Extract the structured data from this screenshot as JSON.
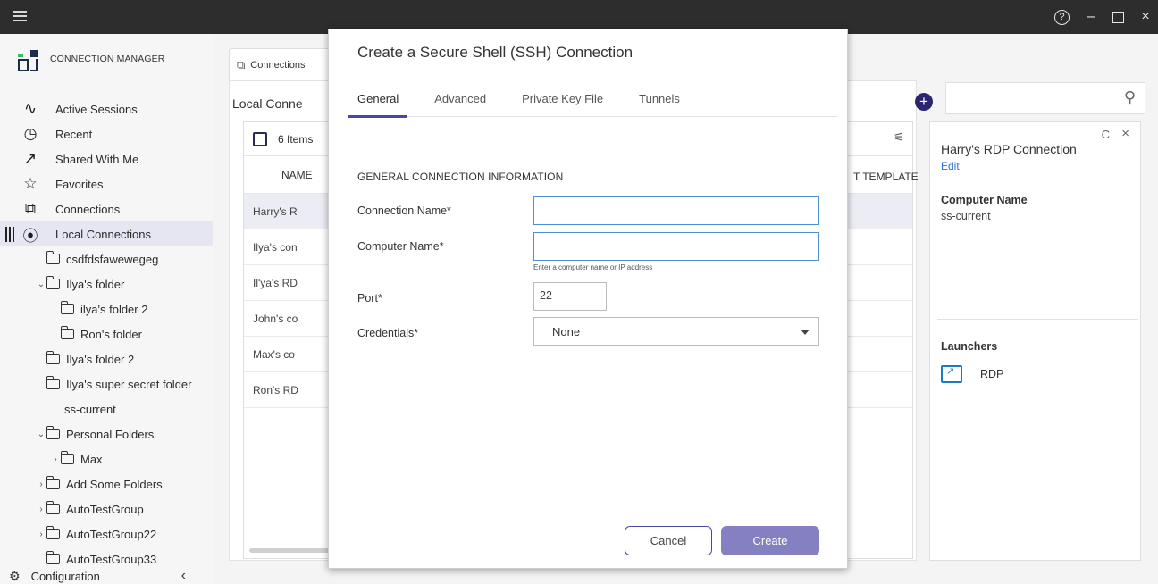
{
  "titlebar": {
    "help_icon": "question-circle-icon",
    "minimize": "–",
    "close": "×"
  },
  "sidebar": {
    "logo_text": "CONNECTION MANAGER",
    "nav": [
      {
        "label": "Active Sessions",
        "icon": "pulse-icon"
      },
      {
        "label": "Recent",
        "icon": "clock-icon"
      },
      {
        "label": "Shared With Me",
        "icon": "arrow-up-right-icon"
      },
      {
        "label": "Favorites",
        "icon": "star-icon"
      },
      {
        "label": "Connections",
        "icon": "external-link-icon"
      },
      {
        "label": "Local Connections",
        "icon": "location-pin-icon"
      }
    ],
    "tree": [
      {
        "label": "csdfdsfawewegeg",
        "indent": 1,
        "chevron": "",
        "folder": true
      },
      {
        "label": "Ilya's folder",
        "indent": 1,
        "chevron": "⌄",
        "folder": true
      },
      {
        "label": "ilya's folder 2",
        "indent": 2,
        "chevron": "",
        "folder": true
      },
      {
        "label": "Ron's folder",
        "indent": 2,
        "chevron": "",
        "folder": true
      },
      {
        "label": "Ilya's folder 2",
        "indent": 1,
        "chevron": "",
        "folder": true
      },
      {
        "label": "Ilya's super secret folder",
        "indent": 1,
        "chevron": "",
        "folder": true
      },
      {
        "label": "ss-current",
        "indent": 0,
        "chevron": "",
        "folder": false
      },
      {
        "label": "Personal Folders",
        "indent": 1,
        "chevron": "⌄",
        "folder": true
      },
      {
        "label": "Max",
        "indent": 2,
        "chevron": "›",
        "folder": true
      },
      {
        "label": "Add Some Folders",
        "indent": 1,
        "chevron": "›",
        "folder": true
      },
      {
        "label": "AutoTestGroup",
        "indent": 1,
        "chevron": "›",
        "folder": true
      },
      {
        "label": "AutoTestGroup22",
        "indent": 1,
        "chevron": "›",
        "folder": true
      },
      {
        "label": "AutoTestGroup33",
        "indent": 1,
        "chevron": "",
        "folder": true
      }
    ],
    "config_label": "Configuration",
    "collapse": "‹"
  },
  "main": {
    "tab_label": "Connections",
    "local_title": "Local Conne",
    "items_count": "6 Items",
    "name_header": "NAME",
    "template_header": "T TEMPLATE",
    "rows": [
      "Harry's R",
      "Ilya's con",
      "Il'ya's RD",
      "John's co",
      "Max's co",
      "Ron's RD"
    ]
  },
  "right_panel": {
    "title": "Harry's RDP Connection",
    "edit": "Edit",
    "computer_name_label": "Computer Name",
    "computer_name_value": "ss-current",
    "launchers_label": "Launchers",
    "launcher": "RDP",
    "refresh": "C",
    "close": "×"
  },
  "modal": {
    "title": "Create a Secure Shell (SSH) Connection",
    "tabs": [
      "General",
      "Advanced",
      "Private Key File",
      "Tunnels"
    ],
    "section": "GENERAL CONNECTION INFORMATION",
    "connection_name_label": "Connection Name*",
    "connection_name_value": "",
    "computer_name_label": "Computer Name*",
    "computer_name_value": "",
    "computer_name_help": "Enter a computer name or IP address",
    "port_label": "Port*",
    "port_value": "22",
    "credentials_label": "Credentials*",
    "credentials_value": "None",
    "cancel": "Cancel",
    "create": "Create"
  }
}
